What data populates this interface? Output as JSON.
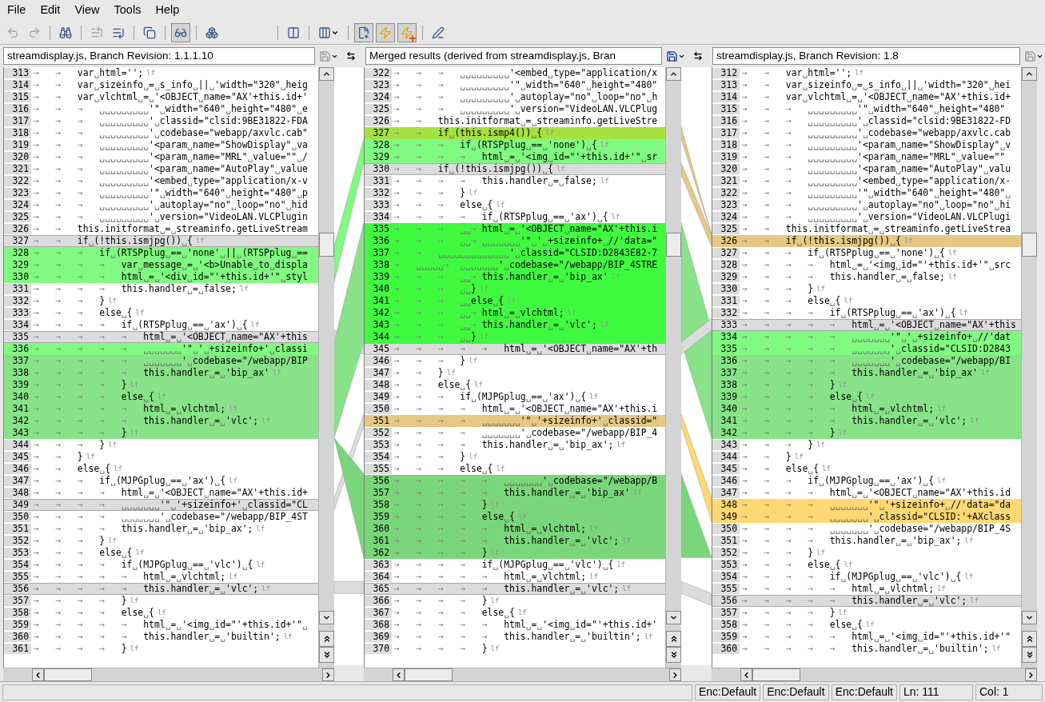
{
  "menu": [
    "File",
    "Edit",
    "View",
    "Tools",
    "Help"
  ],
  "toolbar": [
    {
      "kind": "undo",
      "disabled": true,
      "pressed": false
    },
    {
      "kind": "redo",
      "disabled": true,
      "pressed": false
    },
    {
      "kind": "separator"
    },
    {
      "kind": "find",
      "disabled": false,
      "pressed": false
    },
    {
      "kind": "separator"
    },
    {
      "kind": "prev",
      "disabled": true,
      "pressed": false
    },
    {
      "kind": "next",
      "disabled": false,
      "pressed": false
    },
    {
      "kind": "separator"
    },
    {
      "kind": "copy",
      "disabled": false,
      "pressed": false
    },
    {
      "kind": "separator"
    },
    {
      "kind": "glasses",
      "disabled": false,
      "pressed": true
    },
    {
      "kind": "separator"
    },
    {
      "kind": "merge",
      "disabled": false,
      "pressed": false
    },
    {
      "kind": "spacer"
    },
    {
      "kind": "separator"
    },
    {
      "kind": "split",
      "disabled": false,
      "pressed": false
    },
    {
      "kind": "separator"
    },
    {
      "kind": "columns",
      "disabled": false,
      "pressed": false
    },
    {
      "kind": "separator"
    },
    {
      "kind": "newdoc",
      "disabled": false,
      "pressed": true
    },
    {
      "kind": "zap",
      "disabled": false,
      "pressed": true
    },
    {
      "kind": "zapplus",
      "disabled": false,
      "pressed": true
    },
    {
      "kind": "separator"
    },
    {
      "kind": "edit",
      "disabled": false,
      "pressed": false
    }
  ],
  "panes": [
    {
      "title": "streamdisplay.js, Branch Revision: 1.1.1.10",
      "save_enabled": false,
      "lines": [
        {
          "n": "313",
          "text": "→   →   var␣html='';",
          "eol": "lf",
          "kind": "plain"
        },
        {
          "n": "314",
          "text": "→   →   var␣sizeinfo␣=␣s_info␣||␣'width=\"320\"␣heig",
          "kind": "plain"
        },
        {
          "n": "315",
          "text": "→   →   var␣vlchtml␣=␣'<OBJECT␣name=\"AX'+this.id+'",
          "kind": "plain"
        },
        {
          "n": "316",
          "text": "→   →   →   ␣␣␣␣␣␣␣␣␣'\"␣width=\"640\"␣height=\"480\"␣e",
          "kind": "plain"
        },
        {
          "n": "317",
          "text": "→   →   →   ␣␣␣␣␣␣␣␣␣'␣classid=\"clsid:9BE31822-FDA",
          "kind": "plain"
        },
        {
          "n": "318",
          "text": "→   →   →   ␣␣␣␣␣␣␣␣␣'␣codebase=\"webapp/axvlc.cab\"",
          "kind": "plain"
        },
        {
          "n": "319",
          "text": "→   →   →   ␣␣␣␣␣␣␣␣␣'<param␣name=\"ShowDisplay\"␣va",
          "kind": "plain"
        },
        {
          "n": "320",
          "text": "→   →   →   ␣␣␣␣␣␣␣␣␣'<param␣name=\"MRL\"␣value=\"\"␣/",
          "kind": "plain"
        },
        {
          "n": "321",
          "text": "→   →   →   ␣␣␣␣␣␣␣␣␣'<param␣name=\"AutoPlay\"␣value",
          "kind": "plain"
        },
        {
          "n": "322",
          "text": "→   →   →   ␣␣␣␣␣␣␣␣␣'<embed␣type=\"application/x-v",
          "kind": "plain"
        },
        {
          "n": "323",
          "text": "→   →   →   ␣␣␣␣␣␣␣␣␣'\"␣width=\"640\"␣height=\"480\"␣p",
          "kind": "plain"
        },
        {
          "n": "324",
          "text": "→   →   →   ␣␣␣␣␣␣␣␣␣'␣autoplay=\"no\"␣loop=\"no\"␣hid",
          "kind": "plain"
        },
        {
          "n": "325",
          "text": "→   →   →   ␣␣␣␣␣␣␣␣␣'␣version=\"VideoLAN.VLCPlugin",
          "kind": "plain"
        },
        {
          "n": "326",
          "text": "→   →   this.initformat␣=␣streaminfo.getLiveStream",
          "kind": "plain"
        },
        {
          "n": "327",
          "text": "→   →   if␣(!this.ismjpg())␣{",
          "eol": "lf",
          "kind": "gray"
        },
        {
          "n": "328",
          "text": "→   →   →   if␣(RTSPplug␣==␣'none'␣||␣(RTSPplug␣==",
          "kind": "lightgreen"
        },
        {
          "n": "329",
          "text": "→   →   →   →   var␣message␣=␣'<b>Unable␣to␣displa",
          "kind": "lightgreen"
        },
        {
          "n": "330",
          "text": "→   →   →   →   html␣=␣'<div␣id=\"'+this.id+'\"␣styl",
          "kind": "lightgreen"
        },
        {
          "n": "331",
          "text": "→   →   →   →   this.handler␣=␣false;",
          "eol": "lf",
          "kind": "plain"
        },
        {
          "n": "332",
          "text": "→   →   →   }",
          "eol": "lf",
          "kind": "plain"
        },
        {
          "n": "333",
          "text": "→   →   →   else␣{",
          "eol": "lf",
          "kind": "plain"
        },
        {
          "n": "334",
          "text": "→   →   →   →   if␣(RTSPplug␣==␣'ax')␣{",
          "eol": "lf",
          "kind": "plain"
        },
        {
          "n": "335",
          "text": "→   →   →   →   →   html␣=␣'<OBJECT␣name=\"AX'+this",
          "kind": "gray"
        },
        {
          "n": "336",
          "text": "→   →   →   →   →   ␣␣␣␣␣␣␣'\"␣'␣+sizeinfo+'␣classi",
          "kind": "lightgreen"
        },
        {
          "n": "337",
          "text": "→   →   →   →   →   ␣␣␣␣␣␣␣'␣codebase=\"/webapp/BIP",
          "kind": "midgreen"
        },
        {
          "n": "338",
          "text": "→   →   →   →   →   this.handler␣=␣'bip_ax'",
          "eol": "lf",
          "kind": "midgreen"
        },
        {
          "n": "339",
          "text": "→   →   →   →   }",
          "eol": "lf",
          "kind": "midgreen"
        },
        {
          "n": "340",
          "text": "→   →   →   →   else␣{",
          "eol": "lf",
          "kind": "midgreen"
        },
        {
          "n": "341",
          "text": "→   →   →   →   →   html␣=␣vlchtml;",
          "eol": "lf",
          "kind": "midgreen"
        },
        {
          "n": "342",
          "text": "→   →   →   →   →   this.handler␣=␣'vlc';",
          "eol": "lf",
          "kind": "midgreen"
        },
        {
          "n": "343",
          "text": "→   →   →   →   }",
          "eol": "lf",
          "kind": "midgreen"
        },
        {
          "n": "344",
          "text": "→   →   →   }",
          "eol": "lf",
          "kind": "plain"
        },
        {
          "n": "345",
          "text": "→   →   }",
          "eol": "lf",
          "kind": "plain"
        },
        {
          "n": "346",
          "text": "→   →   else␣{",
          "eol": "lf",
          "kind": "plain"
        },
        {
          "n": "347",
          "text": "→   →   →   if␣(MJPGplug␣==␣'ax')␣{",
          "eol": "lf",
          "kind": "plain"
        },
        {
          "n": "348",
          "text": "→   →   →   →   html␣=␣'<OBJECT␣name=\"AX'+this.id+",
          "kind": "plain"
        },
        {
          "n": "349",
          "text": "→   →   →   →   ␣␣␣␣␣␣␣'\"␣'+sizeinfo+'␣classid=\"CL",
          "kind": "gray"
        },
        {
          "n": "350",
          "text": "→   →   →   →   ␣␣␣␣␣␣␣'␣codebase=\"/webapp/BIP_4ST",
          "kind": "plain"
        },
        {
          "n": "351",
          "text": "→   →   →   →   this.handler␣=␣'bip_ax';",
          "eol": "lf",
          "kind": "plain"
        },
        {
          "n": "352",
          "text": "→   →   →   }",
          "eol": "lf",
          "kind": "plain"
        },
        {
          "n": "353",
          "text": "→   →   →   else␣{",
          "eol": "lf",
          "kind": "plain"
        },
        {
          "n": "354",
          "text": "→   →   →   →   if␣(MJPGplug␣==␣'vlc')␣{",
          "eol": "lf",
          "kind": "plain"
        },
        {
          "n": "355",
          "text": "→   →   →   →   →   html␣=␣vlchtml;",
          "eol": "lf",
          "kind": "plain"
        },
        {
          "n": "356",
          "text": "→   →   →   →   →   this.handler␣=␣'vlc';",
          "eol": "lf",
          "kind": "gray"
        },
        {
          "n": "357",
          "text": "→   →   →   →   }",
          "eol": "lf",
          "kind": "plain"
        },
        {
          "n": "358",
          "text": "→   →   →   →   else␣{",
          "eol": "lf",
          "kind": "plain"
        },
        {
          "n": "359",
          "text": "→   →   →   →   →   html␣=␣'<img␣id=\"'+this.id+'\"␣",
          "kind": "plain"
        },
        {
          "n": "360",
          "text": "→   →   →   →   →   this.handler␣=␣'builtin';",
          "eol": "lf",
          "kind": "plain"
        },
        {
          "n": "361",
          "text": "→   →   →   →   }",
          "eol": "lf",
          "kind": "plain"
        }
      ]
    },
    {
      "title": "Merged results (derived from streamdisplay.js, Bran",
      "save_enabled": true,
      "lines": [
        {
          "n": "322",
          "text": "→   →   →   ␣␣␣␣␣␣␣␣␣'<embed␣type=\"application/x",
          "kind": "plain"
        },
        {
          "n": "323",
          "text": "→   →   →   ␣␣␣␣␣␣␣␣␣'\"␣width=\"640\"␣height=\"480\"",
          "kind": "plain"
        },
        {
          "n": "324",
          "text": "→   →   →   ␣␣␣␣␣␣␣␣␣'␣autoplay=\"no\"␣loop=\"no\"␣h",
          "kind": "plain"
        },
        {
          "n": "325",
          "text": "→   →   →   ␣␣␣␣␣␣␣␣␣'␣version=\"VideoLAN.VLCPlug",
          "kind": "plain"
        },
        {
          "n": "326",
          "text": "→   →   this.initformat␣=␣streaminfo.getLiveStre",
          "kind": "plain"
        },
        {
          "n": "327",
          "text": "→   →   if␣(this.ismp4())␣{",
          "eol": "lf",
          "kind": "olive"
        },
        {
          "n": "328",
          "text": "→   →   →   if␣(RTSPplug␣==␣'none')␣{",
          "eol": "lf",
          "kind": "lightgreen"
        },
        {
          "n": "329",
          "text": "→   →   →   →   html␣=␣'<img␣id=\"'+this.id+'\"␣sr",
          "kind": "lightgreen"
        },
        {
          "n": "330",
          "text": "→   →   if␣(!this.ismjpg())␣{",
          "eol": "lf",
          "kind": "gray"
        },
        {
          "n": "331",
          "text": "→   →   →   →   this.handler␣=␣false;",
          "eol": "lf",
          "kind": "plain"
        },
        {
          "n": "332",
          "text": "→   →   →   }",
          "eol": "lf",
          "kind": "plain"
        },
        {
          "n": "333",
          "text": "→   →   →   else␣{",
          "eol": "lf",
          "kind": "plain"
        },
        {
          "n": "334",
          "text": "→   →   →   →   if␣(RTSPplug␣==␣'ax')␣{",
          "eol": "lf",
          "kind": "plain"
        },
        {
          "n": "335",
          "text": "→   →   →   ␣␣→ html␣=␣'<OBJECT␣name=\"AX'+this.i",
          "kind": "green"
        },
        {
          "n": "336",
          "text": "→   →   →   ␣␣→ ␣␣␣␣␣␣␣'\"␣'␣+sizeinfo+␣//'data=\"",
          "kind": "green"
        },
        {
          "n": "337",
          "text": "→   →   ␣␣␣␣␣␣␣␣␣␣␣␣␣'␣classid=\"CLSID:D2843E82-7",
          "kind": "green"
        },
        {
          "n": "338",
          "text": "→   ␣␣␣␣␣→  ␣␣␣␣␣␣␣'␣codebase=\"/webapp/BIP_4STRE",
          "kind": "green"
        },
        {
          "n": "339",
          "text": "→   →   →   ␣␣→ this.handler␣=␣'bip_ax'",
          "eol": "lf",
          "kind": "green"
        },
        {
          "n": "340",
          "text": "→   →   →   ␣␣}",
          "eol": "lf",
          "kind": "green"
        },
        {
          "n": "341",
          "text": "→   →   →   ␣␣else␣{",
          "eol": "lf",
          "kind": "green"
        },
        {
          "n": "342",
          "text": "→   →   →   ␣␣→ html␣=␣vlchtml;",
          "eol": "lf",
          "kind": "green"
        },
        {
          "n": "343",
          "text": "→   →   →   ␣␣→ this.handler␣=␣'vlc';",
          "eol": "lf",
          "kind": "green"
        },
        {
          "n": "344",
          "text": "→   →   →   ␣␣}",
          "eol": "lf",
          "kind": "green"
        },
        {
          "n": "345",
          "text": "→   →   →   →   →   html␣=␣'<OBJECT␣name=\"AX'+th",
          "kind": "gray"
        },
        {
          "n": "346",
          "text": "→   →   →   }",
          "eol": "lf",
          "kind": "plain"
        },
        {
          "n": "347",
          "text": "→   →   }",
          "eol": "lf",
          "kind": "plain"
        },
        {
          "n": "348",
          "text": "→   →   else␣{",
          "eol": "lf",
          "kind": "plain"
        },
        {
          "n": "349",
          "text": "→   →   →   if␣(MJPGplug␣==␣'ax')␣{",
          "eol": "lf",
          "kind": "plain"
        },
        {
          "n": "350",
          "text": "→   →   →   →   html␣=␣'<OBJECT␣name=\"AX'+this.i",
          "kind": "plain"
        },
        {
          "n": "351",
          "text": "→   →   →   →   ␣␣␣␣␣␣␣'\"␣'+sizeinfo+'␣classid=\"",
          "kind": "tan"
        },
        {
          "n": "352",
          "text": "→   →   →   →   ␣␣␣␣␣␣␣'␣codebase=\"/webapp/BIP_4",
          "kind": "plain"
        },
        {
          "n": "353",
          "text": "→   →   →   →   this.handler␣=␣'bip_ax';",
          "eol": "lf",
          "kind": "plain"
        },
        {
          "n": "354",
          "text": "→   →   →   }",
          "eol": "lf",
          "kind": "plain"
        },
        {
          "n": "355",
          "text": "→   →   →   else␣{",
          "eol": "lf",
          "kind": "plain"
        },
        {
          "n": "356",
          "text": "→   →   →   →   →   ␣␣␣␣␣␣␣'␣codebase=\"/webapp/B",
          "kind": "darkgreen"
        },
        {
          "n": "357",
          "text": "→   →   →   →   →   this.handler␣=␣'bip_ax'",
          "eol": "lf",
          "kind": "darkgreen"
        },
        {
          "n": "358",
          "text": "→   →   →   →   }",
          "eol": "lf",
          "kind": "darkgreen"
        },
        {
          "n": "359",
          "text": "→   →   →   →   else␣{",
          "eol": "lf",
          "kind": "darkgreen"
        },
        {
          "n": "360",
          "text": "→   →   →   →   →   html␣=␣vlchtml;",
          "eol": "lf",
          "kind": "darkgreen"
        },
        {
          "n": "361",
          "text": "→   →   →   →   →   this.handler␣=␣'vlc';",
          "eol": "lf",
          "kind": "darkgreen"
        },
        {
          "n": "362",
          "text": "→   →   →   →   }",
          "eol": "lf",
          "kind": "darkgreen"
        },
        {
          "n": "363",
          "text": "→   →   →   →   if␣(MJPGplug␣==␣'vlc')␣{",
          "eol": "lf",
          "kind": "plain"
        },
        {
          "n": "364",
          "text": "→   →   →   →   →   html␣=␣vlchtml;",
          "eol": "lf",
          "kind": "plain"
        },
        {
          "n": "365",
          "text": "→   →   →   →   →   this.handler␣=␣'vlc';",
          "eol": "lf",
          "kind": "gray"
        },
        {
          "n": "366",
          "text": "→   →   →   →   }",
          "eol": "lf",
          "kind": "plain"
        },
        {
          "n": "367",
          "text": "→   →   →   →   else␣{",
          "eol": "lf",
          "kind": "plain"
        },
        {
          "n": "368",
          "text": "→   →   →   →   →   html␣=␣'<img␣id=\"'+this.id+'",
          "kind": "plain"
        },
        {
          "n": "369",
          "text": "→   →   →   →   →   this.handler␣=␣'builtin';",
          "eol": "lf",
          "kind": "plain"
        },
        {
          "n": "370",
          "text": "→   →   →   →   }",
          "eol": "lf",
          "kind": "plain"
        }
      ]
    },
    {
      "title": "streamdisplay.js, Branch Revision: 1.8",
      "save_enabled": false,
      "lines": [
        {
          "n": "312",
          "text": "→   →   var␣html='';",
          "eol": "lf",
          "kind": "plain"
        },
        {
          "n": "313",
          "text": "→   →   var␣sizeinfo␣=␣s_info␣||␣'width=\"320\"␣hei",
          "kind": "plain"
        },
        {
          "n": "314",
          "text": "→   →   var␣vlchtml␣=␣'<OBJECT␣name=\"AX'+this.id+",
          "kind": "plain"
        },
        {
          "n": "315",
          "text": "→   →   →   ␣␣␣␣␣␣␣␣␣'\"␣width=\"640\"␣height=\"480\"",
          "kind": "plain"
        },
        {
          "n": "316",
          "text": "→   →   →   ␣␣␣␣␣␣␣␣␣'␣classid=\"clsid:9BE31822-FD",
          "kind": "plain"
        },
        {
          "n": "317",
          "text": "→   →   →   ␣␣␣␣␣␣␣␣␣'␣codebase=\"webapp/axvlc.cab",
          "kind": "plain"
        },
        {
          "n": "318",
          "text": "→   →   →   ␣␣␣␣␣␣␣␣␣'<param␣name=\"ShowDisplay\"␣v",
          "kind": "plain"
        },
        {
          "n": "319",
          "text": "→   →   →   ␣␣␣␣␣␣␣␣␣'<param␣name=\"MRL\"␣value=\"\"",
          "kind": "plain"
        },
        {
          "n": "320",
          "text": "→   →   →   ␣␣␣␣␣␣␣␣␣'<param␣name=\"AutoPlay\"␣valu",
          "kind": "plain"
        },
        {
          "n": "321",
          "text": "→   →   →   ␣␣␣␣␣␣␣␣␣'<embed␣type=\"application/x-",
          "kind": "plain"
        },
        {
          "n": "322",
          "text": "→   →   →   ␣␣␣␣␣␣␣␣␣'\"␣width=\"640\"␣height=\"480\"␣",
          "kind": "plain"
        },
        {
          "n": "323",
          "text": "→   →   →   ␣␣␣␣␣␣␣␣␣'␣autoplay=\"no\"␣loop=\"no\"␣hi",
          "kind": "plain"
        },
        {
          "n": "324",
          "text": "→   →   →   ␣␣␣␣␣␣␣␣␣'␣version=\"VideoLAN.VLCPlugi",
          "kind": "plain"
        },
        {
          "n": "325",
          "text": "→   →   this.initformat␣=␣streaminfo.getLiveStrea",
          "kind": "plain"
        },
        {
          "n": "326",
          "text": "→   →   if␣(!this.ismjpg())␣{",
          "eol": "lf",
          "kind": "tan"
        },
        {
          "n": "327",
          "text": "→   →   →   if␣(RTSPplug␣==␣'none')␣{",
          "eol": "lf",
          "kind": "plain"
        },
        {
          "n": "328",
          "text": "→   →   →   →   html␣=␣'<img␣id=\"'+this.id+'\"␣src",
          "kind": "plain"
        },
        {
          "n": "329",
          "text": "→   →   →   →   this.handler␣=␣false;",
          "eol": "lf",
          "kind": "plain"
        },
        {
          "n": "330",
          "text": "→   →   →   }",
          "eol": "lf",
          "kind": "plain"
        },
        {
          "n": "331",
          "text": "→   →   →   else␣{",
          "eol": "lf",
          "kind": "plain"
        },
        {
          "n": "332",
          "text": "→   →   →   →   if␣(RTSPplug␣==␣'ax')␣{",
          "eol": "lf",
          "kind": "plain"
        },
        {
          "n": "333",
          "text": "→   →   →   →   →   html␣=␣'<OBJECT␣name=\"AX'+this",
          "kind": "gray"
        },
        {
          "n": "334",
          "text": "→   →   →   →   →   ␣␣␣␣␣␣␣'\"␣'␣+sizeinfo+␣//'dat",
          "kind": "lightgreen"
        },
        {
          "n": "335",
          "text": "→   →   →   →   →   ␣␣␣␣␣␣␣'␣classid=\"CLSID:D2843",
          "kind": "lightgreen"
        },
        {
          "n": "336",
          "text": "→   →   →   →   →   ␣␣␣␣␣␣␣'␣codebase=\"/webapp/BI",
          "kind": "midgreen"
        },
        {
          "n": "337",
          "text": "→   →   →   →   →   this.handler␣=␣'bip_ax'",
          "eol": "lf",
          "kind": "midgreen"
        },
        {
          "n": "338",
          "text": "→   →   →   →   }",
          "eol": "lf",
          "kind": "midgreen"
        },
        {
          "n": "339",
          "text": "→   →   →   →   else␣{",
          "eol": "lf",
          "kind": "midgreen"
        },
        {
          "n": "340",
          "text": "→   →   →   →   →   html␣=␣vlchtml;",
          "eol": "lf",
          "kind": "midgreen"
        },
        {
          "n": "341",
          "text": "→   →   →   →   →   this.handler␣=␣'vlc';",
          "eol": "lf",
          "kind": "midgreen"
        },
        {
          "n": "342",
          "text": "→   →   →   →   }",
          "eol": "lf",
          "kind": "midgreen"
        },
        {
          "n": "343",
          "text": "→   →   →   }",
          "eol": "lf",
          "kind": "plain"
        },
        {
          "n": "344",
          "text": "→   →   }",
          "eol": "lf",
          "kind": "plain"
        },
        {
          "n": "345",
          "text": "→   →   else␣{",
          "eol": "lf",
          "kind": "plain"
        },
        {
          "n": "346",
          "text": "→   →   →   if␣(MJPGplug␣==␣'ax')␣{",
          "eol": "lf",
          "kind": "plain"
        },
        {
          "n": "347",
          "text": "→   →   →   →   html␣=␣'<OBJECT␣name=\"AX'+this.id",
          "kind": "plain"
        },
        {
          "n": "348",
          "text": "→   →   →   →   ␣␣␣␣␣␣␣'\"␣'+sizeinfo+␣//'data=\"da",
          "kind": "yellow"
        },
        {
          "n": "349",
          "text": "→   →   →   →   ␣␣␣␣␣␣␣'␣classid=\"CLSID:'+AXclass",
          "kind": "yellow"
        },
        {
          "n": "350",
          "text": "→   →   →   →   ␣␣␣␣␣␣␣'␣codebase=\"/webapp/BIP_4S",
          "kind": "plain"
        },
        {
          "n": "351",
          "text": "→   →   →   →   this.handler␣=␣'bip_ax';",
          "eol": "lf",
          "kind": "plain"
        },
        {
          "n": "352",
          "text": "→   →   →   }",
          "eol": "lf",
          "kind": "plain"
        },
        {
          "n": "353",
          "text": "→   →   →   else␣{",
          "eol": "lf",
          "kind": "plain"
        },
        {
          "n": "354",
          "text": "→   →   →   →   if␣(MJPGplug␣==␣'vlc')␣{",
          "eol": "lf",
          "kind": "plain"
        },
        {
          "n": "355",
          "text": "→   →   →   →   →   html␣=␣vlchtml;",
          "eol": "lf",
          "kind": "plain"
        },
        {
          "n": "356",
          "text": "→   →   →   →   →   this.handler␣=␣'vlc';",
          "eol": "lf",
          "kind": "gray"
        },
        {
          "n": "357",
          "text": "→   →   →   →   }",
          "eol": "lf",
          "kind": "plain"
        },
        {
          "n": "358",
          "text": "→   →   →   →   else␣{",
          "eol": "lf",
          "kind": "plain"
        },
        {
          "n": "359",
          "text": "→   →   →   →   →   html␣=␣'<img␣id=\"'+this.id+'\"",
          "kind": "plain"
        },
        {
          "n": "360",
          "text": "→   →   →   →   →   this.handler␣=␣'builtin';",
          "eol": "lf",
          "kind": "plain"
        }
      ]
    }
  ],
  "status_bar": [
    "Enc:Default",
    "Enc:Default",
    "Enc:Default",
    "Ln: 111",
    "Col: 1"
  ]
}
